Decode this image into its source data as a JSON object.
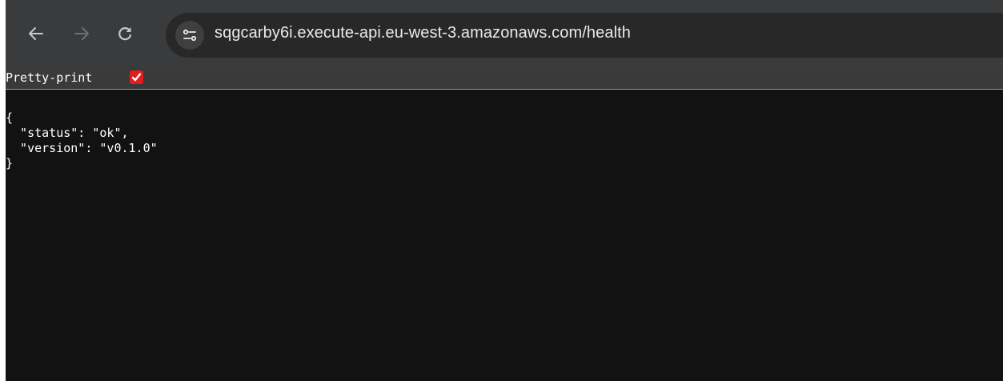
{
  "browser": {
    "url": "sqgcarby6i.execute-api.eu-west-3.amazonaws.com/health",
    "icons": {
      "back": "arrow-left-icon",
      "forward": "arrow-right-icon",
      "reload": "reload-icon",
      "site_info": "tune-icon"
    }
  },
  "viewer": {
    "pretty_print_label": "Pretty-print",
    "pretty_print_checked": true,
    "check_color": "#e11d1d"
  },
  "json_lines": [
    "{",
    "  \"status\": \"ok\",",
    "  \"version\": \"v0.1.0\"",
    "}"
  ]
}
